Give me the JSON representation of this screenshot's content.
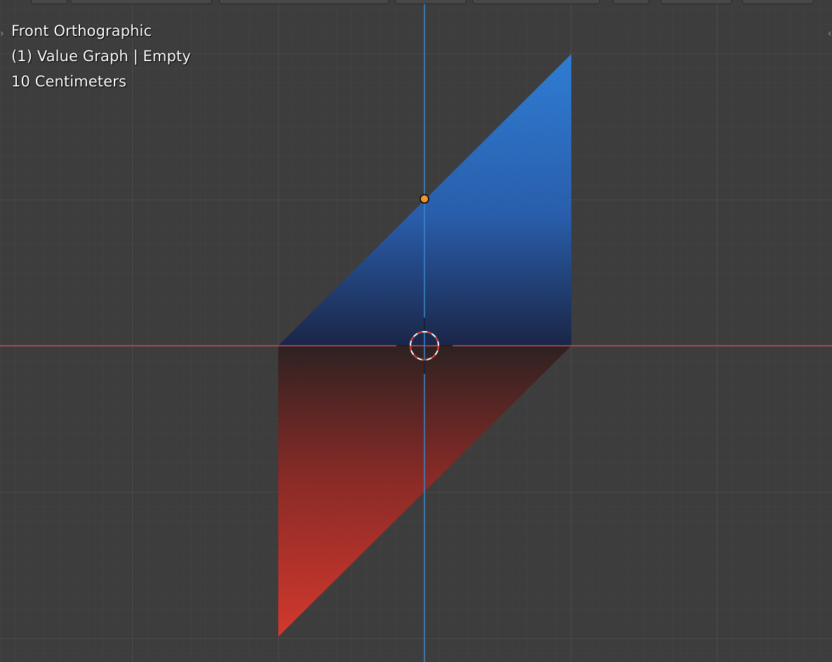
{
  "viewport": {
    "view_name": "Front Orthographic",
    "object_info": "(1) Value Graph | Empty",
    "grid_scale": "10 Centimeters"
  },
  "colors": {
    "background": "#3d3d3d",
    "grid_minor": "#444444",
    "grid_major": "#4d4d4d",
    "x_axis": "#c44a5a",
    "z_axis": "#3b86cc",
    "positive_fill_top": "#2f7fd6",
    "positive_fill_bottom": "#1c2f5a",
    "negative_fill_top": "#3a2222",
    "negative_fill_bottom": "#d6392e",
    "origin_point": "#f0962a",
    "cursor_ring_red": "#d63a3a",
    "cursor_ring_white": "#ffffff"
  },
  "icons": {
    "left_edge_tab": "chevron-right-icon",
    "right_edge_tab": "sidebar-toggle-icon",
    "cursor": "3d-cursor-icon",
    "origin": "object-origin-icon"
  }
}
